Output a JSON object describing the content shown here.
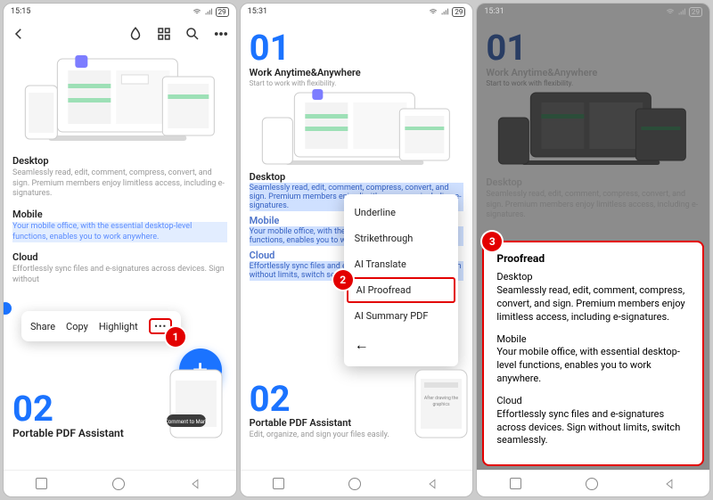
{
  "status": {
    "time1": "15:15",
    "time2": "15:31",
    "time3": "15:31",
    "batt": "29"
  },
  "p1": {
    "heading_num": "02",
    "heading_title": "Portable PDF Assistant",
    "desktop": {
      "h": "Desktop",
      "p": "Seamlessly read, edit, comment, compress, convert, and sign. Premium members enjoy limitless access, including e-signatures."
    },
    "mobile": {
      "h": "Mobile",
      "p": "Your mobile office, with the essential desktop-level functions, enables you to work anywhere."
    },
    "cloud": {
      "h": "Cloud",
      "p": "Effortlessly sync files and e-signatures across devices. Sign without"
    },
    "ctx": {
      "share": "Share",
      "copy": "Copy",
      "highlight": "Highlight",
      "more": "⋯"
    },
    "badge": "1"
  },
  "p2": {
    "num": "01",
    "title": "Work Anytime&Anywhere",
    "sub": "Start to work with flexibility.",
    "desktop": {
      "h": "Desktop",
      "p": "Seamlessly read, edit, comment, compress, convert, and sign. Premium members enjoy limitless access, including e-signatures."
    },
    "mobile": {
      "h": "Mobile",
      "p": "Your mobile office, with the essential desktop-level functions, enables you to work anywhere."
    },
    "cloud": {
      "h": "Cloud",
      "p": "Effortlessly sync files and e-signatures across devices. Sign without limits, switch seamlessly.."
    },
    "menu": {
      "underline": "Underline",
      "strike": "Strikethrough",
      "translate": "AI Translate",
      "proofread": "AI Proofread",
      "summary": "AI Summary PDF"
    },
    "badge": "2",
    "bottom": {
      "num": "02",
      "title": "Portable PDF Assistant",
      "sub": "Edit, organize, and sign your files easily."
    }
  },
  "p3": {
    "num": "01",
    "title": "Work Anytime&Anywhere",
    "sub": "Start to work with flexibility.",
    "desktop": {
      "h": "Desktop",
      "p": "Seamlessly read, edit, comment, compress, convert, and sign. Premium members enjoy limitless access, including e-signatures."
    },
    "sheet": {
      "title": "Proofread",
      "desktop": {
        "h": "Desktop",
        "p": "Seamlessly read, edit, comment, compress, convert, and sign. Premium members enjoy limitless access, including e-signatures."
      },
      "mobile": {
        "h": "Mobile",
        "p": "Your mobile office, with essential desktop-level functions, enables you to work anywhere."
      },
      "cloud": {
        "h": "Cloud",
        "p": "Effortlessly sync files and e-signatures across devices. Sign without limits, switch seamlessly."
      }
    },
    "badge": "3"
  }
}
